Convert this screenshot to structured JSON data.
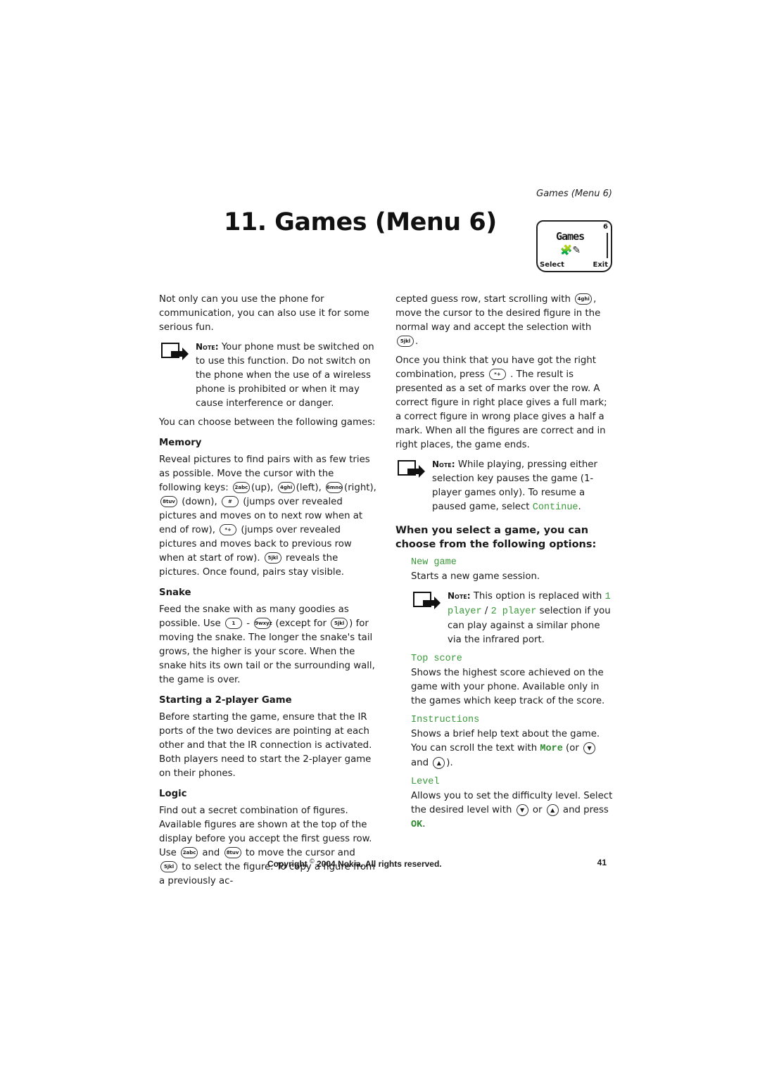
{
  "header": {
    "running_head": "Games (Menu 6)",
    "chapter_title": "11. Games (Menu 6)"
  },
  "phone_display": {
    "title": "Games",
    "menu_number": "6",
    "icon": "puzzle-pieces-and-game-icon",
    "left_softkey": "Select",
    "right_softkey": "Exit"
  },
  "left_column": {
    "intro": "Not only can you use the phone for communication, you can also use it for some serious fun.",
    "note1": {
      "label": "Note:",
      "text": "Your phone must be switched on to use this function. Do not switch on the phone when the use of a wireless phone is prohibited or when it may cause interference or danger."
    },
    "choose_text": "You can choose between the following games:",
    "memory": {
      "heading": "Memory",
      "t1": "Reveal pictures to find pairs with as few tries as possible. Move the cursor with the following keys:",
      "k2": "2abc",
      "up": "(up),",
      "k4": "4ghi",
      "left": "(left),",
      "k6": "6mno",
      "right": "(right),",
      "k8": "8tuv",
      "down": "(down),",
      "khash": "#",
      "t_hash": "(jumps over revealed pictures and moves on to next row when at end of row),",
      "kstar": "*+",
      "t_star": "(jumps over revealed pictures and moves back to previous row when at start of row).",
      "k5": "5jkl",
      "t_end": "reveals the pictures. Once found, pairs stay visible."
    },
    "snake": {
      "heading": "Snake",
      "t1": "Feed the snake with as many goodies as possible. Use",
      "k1": "1",
      "dash": "-",
      "k9": "9wxyz",
      "t2": "(except for",
      "k5": "5jkl",
      "t3": ") for moving the snake. The longer the snake's tail grows, the higher is your score. When the snake hits its own tail or the surrounding wall, the game is over."
    },
    "two_player": {
      "heading": "Starting a 2-player Game",
      "text": "Before starting the game, ensure that the IR ports of the two devices are pointing at each other and that the IR connection is activated. Both players need to start the 2-player game on their phones."
    },
    "logic": {
      "heading": "Logic",
      "t1": "Find out a secret combination of figures. Available figures are shown at the top of the display before you accept the first guess row. Use",
      "k2": "2abc",
      "and": "and",
      "k8": "8tuv",
      "t2": "to move the cursor and",
      "k5": "5jkl",
      "t3": "to select the figure. To copy a figure from a previously ac-"
    }
  },
  "right_column": {
    "logic_cont": {
      "t1": "cepted guess row, start scrolling with",
      "k4": "4ghi",
      "t2": ", move the cursor to the desired figure in the normal way and accept the selection with",
      "k5": "5jkl",
      "t3": "."
    },
    "combination": {
      "t1": "Once you think that you have got the right combination, press",
      "kstar": "*+",
      "t2": ". The result is presented as a set of marks over the row. A correct figure in right place gives a full mark; a correct figure in wrong place gives a half a mark. When all the figures are correct and in right places, the game ends."
    },
    "note2": {
      "label": "Note:",
      "text": "While playing, pressing either selection key pauses the game (1-player games only). To resume a paused game, select",
      "continue": "Continue",
      "end": "."
    },
    "options_heading": "When you select a game, you can choose from the following options:",
    "options": {
      "new_game": {
        "name": "New game",
        "desc": "Starts a new game session."
      },
      "note3": {
        "label": "Note:",
        "t1": "This option is replaced with",
        "one_player": "1 player",
        "slash": "/",
        "two_player": "2 player",
        "t2": "selection if you can play against a similar phone via the infrared port."
      },
      "top_score": {
        "name": "Top score",
        "desc": "Shows the highest score achieved on the game with your phone. Available only in the games which keep track of the score."
      },
      "instructions": {
        "name": "Instructions",
        "t1": "Shows a brief help text about the game. You can scroll the text with",
        "more": "More",
        "t2": "(or",
        "and": "and",
        "t3": ")."
      },
      "level": {
        "name": "Level",
        "t1": "Allows you to set the difficulty level. Select the desired level with",
        "or": "or",
        "t2": "and press",
        "ok": "OK",
        "t3": "."
      }
    }
  },
  "footer": {
    "copyright_pre": "Copyright",
    "copyright_symbol": "©",
    "copyright_post": "2004 Nokia. All rights reserved.",
    "page_number": "41"
  },
  "colors": {
    "menu_text_green": "#3a9a3a",
    "text": "#1a1a1a"
  }
}
